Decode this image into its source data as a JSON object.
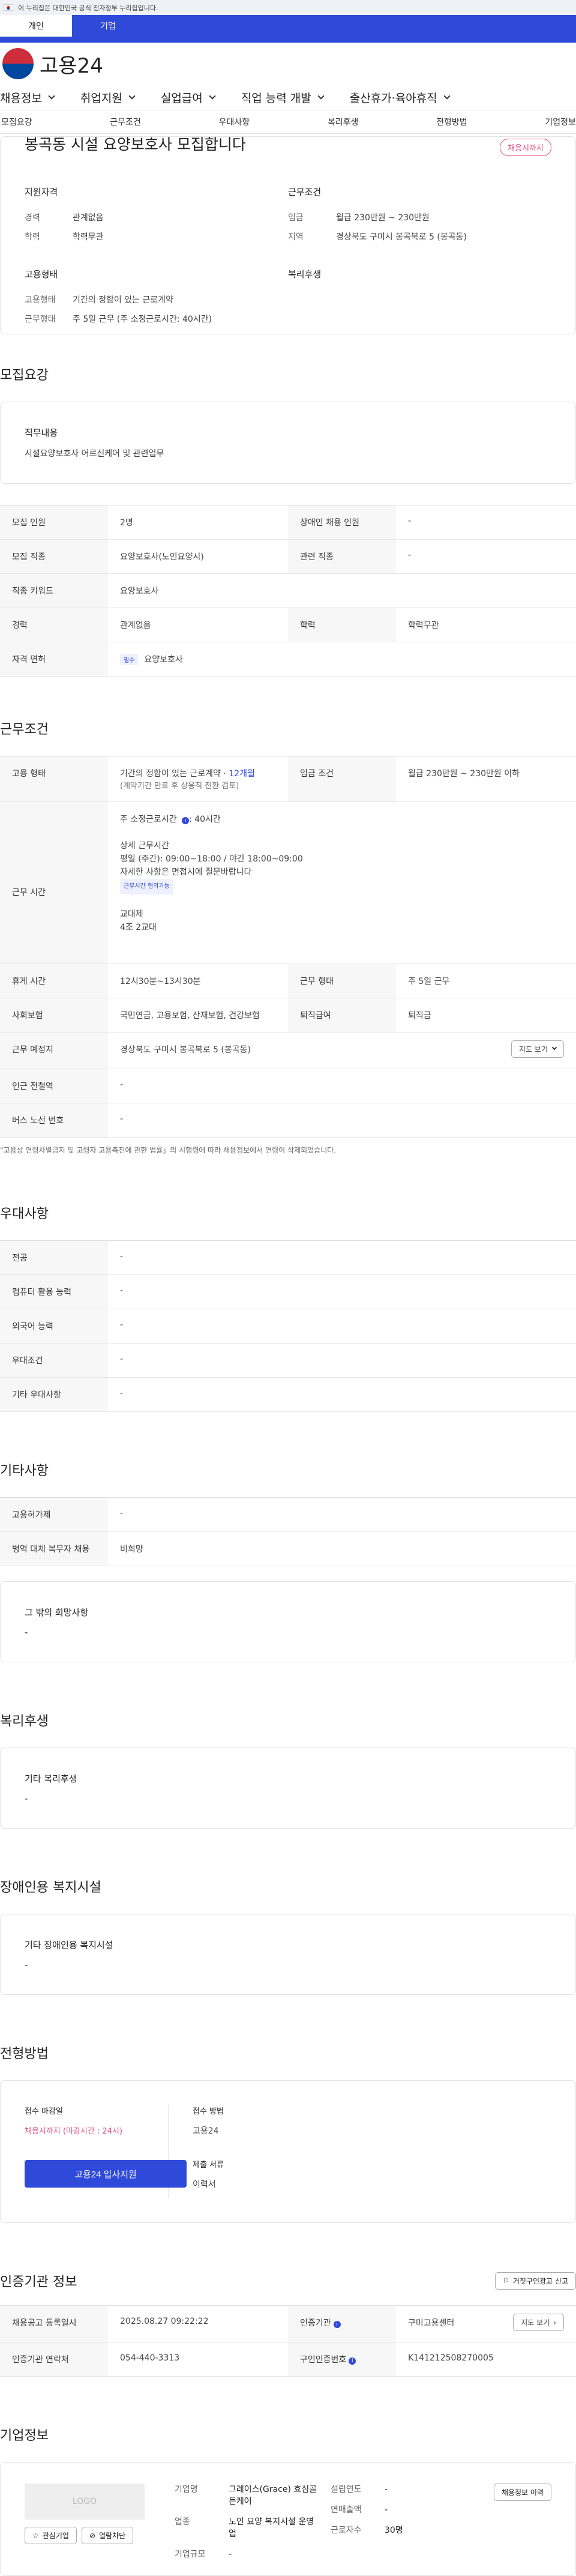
{
  "gov_banner": "이 누리집은 대한민국 공식 전자정부 누리집입니다.",
  "user_tabs": [
    "개인",
    "기업"
  ],
  "logo": "고용24",
  "main_nav": [
    "채용정보",
    "취업지원",
    "실업급여",
    "직업 능력 개발",
    "출산휴가·육아휴직"
  ],
  "sub_nav": [
    "모집요강",
    "근무조건",
    "우대사항",
    "복리후생",
    "전형방법",
    "기업정보"
  ],
  "summary": {
    "title": "봉곡동 시설 요양보호사 모집합니다",
    "badge": "채용시까지",
    "qual_head": "지원자격",
    "career_k": "경력",
    "career_v": "관계없음",
    "edu_k": "학력",
    "edu_v": "학력무관",
    "cond_head": "근무조건",
    "pay_k": "임금",
    "pay_v": "월급 230만원 ~ 230만원",
    "loc_k": "지역",
    "loc_v": "경상북도 구미시 봉곡북로 5 (봉곡동)",
    "form_head": "고용형태",
    "type_k": "고용형태",
    "type_v": "기간의 정함이 있는 근로계약",
    "work_k": "근무형태",
    "work_v": "주 5일 근무 (주 소정근로시간: 40시간)",
    "welfare_head": "복리후생"
  },
  "recruit": {
    "title": "모집요강",
    "duty_head": "직무내용",
    "duty": "시설요양보호사 어르신케어 및 관련업무",
    "r1": [
      "모집 인원",
      "2명",
      "장애인 채용 인원",
      "-"
    ],
    "r2": [
      "모집 직종",
      "요양보호사(노인요양시)",
      "관련 직종",
      "-"
    ],
    "r3": [
      "직종 키워드",
      "요양보호사"
    ],
    "r4": [
      "경력",
      "관계없음",
      "학력",
      "학력무관"
    ],
    "r5": [
      "자격 면허",
      "필수",
      "요양보호사"
    ]
  },
  "conditions": {
    "title": "근무조건",
    "emp": [
      "고용 형태",
      "기간의 정함이 있는 근로계약 · ",
      "12개월",
      "(계약기간 만료 후 상용직 전환 검토)",
      "임금 조건",
      "월급 230만원 ~ 230만원 이하"
    ],
    "hours_k": "근무 시간",
    "hours_1": "주 소정근로시간 ",
    "hours_1b": ": 40시간",
    "hours_2": "상세 근무시간",
    "hours_3": "평일 (주간): 09:00~18:00 / 야간 18:00~09:00",
    "hours_4": "자세한 사항은 면접시에 질문바랍니다",
    "hours_tag": "근무시간 협의가능",
    "hours_5": "교대제",
    "hours_6": "4조 2교대",
    "rest": [
      "휴게 시간",
      "12시30분~13시30분",
      "근무 형태",
      "주 5일 근무"
    ],
    "ins": [
      "사회보험",
      "국민연금, 고용보험, 산재보험, 건강보험",
      "퇴직급여",
      "퇴직금"
    ],
    "place": [
      "근무 예정지",
      "경상북도 구미시 봉곡북로 5 (봉곡동)",
      "지도 보기"
    ],
    "station": [
      "인근 전철역",
      "-"
    ],
    "bus": [
      "버스 노선 번호",
      "-"
    ],
    "note": "\"고용상 연령차별금지 및 고령자 고용촉진에 관한 법률」의 시행령에 따라 채용정보에서 연령이 삭제되었습니다."
  },
  "prefer": {
    "title": "우대사항",
    "rows": [
      [
        "전공",
        "-"
      ],
      [
        "컴퓨터 활용 능력",
        "-"
      ],
      [
        "외국어 능력",
        "-"
      ],
      [
        "우대조건",
        "-"
      ],
      [
        "기타 우대사항",
        "-"
      ]
    ]
  },
  "etc": {
    "title": "기타사항",
    "rows": [
      [
        "고용허가제",
        "-"
      ],
      [
        "병역 대체 복무자 채용",
        "비희망"
      ]
    ],
    "box_head": "그 밖의 희망사항",
    "box_val": "-"
  },
  "welfare": {
    "title": "복리후생",
    "head": "기타 복리후생",
    "val": "-"
  },
  "disabled": {
    "title": "장애인용 복지시설",
    "head": "기타 장애인용 복지시설",
    "val": "-"
  },
  "apply": {
    "title": "전형방법",
    "deadline_k": "접수 마감일",
    "deadline_v": "채용시까지 (마감시간 : 24시)",
    "button": "고용24 입사지원",
    "method_k": "접수 방법",
    "method_v": "고용24",
    "docs_k": "제출 서류",
    "docs_v": "이력서"
  },
  "agency": {
    "title": "인증기관 정보",
    "report": "거짓구인광고 신고",
    "r1": [
      "채용공고 등록일시",
      "2025.08.27 09:22:22",
      "인증기관",
      "구미고용센터",
      "지도 보기"
    ],
    "r2": [
      "인증기관 연락처",
      "054-440-3313",
      "구인인증번호",
      "K141212508270005"
    ]
  },
  "company": {
    "title": "기업정보",
    "logo": "LOGO",
    "fav": "관심기업",
    "block": "열람차단",
    "name_k": "기업명",
    "name_v": "그레이스(Grace) 효심골든케어",
    "ind_k": "업종",
    "ind_v": "노인 요양 복지시설 운영업",
    "size_k": "기업규모",
    "size_v": "-",
    "year_k": "설립연도",
    "year_v": "-",
    "sales_k": "연매출액",
    "sales_v": "-",
    "staff_k": "근로자수",
    "staff_v": "30명",
    "more": "채용정보 이력"
  }
}
